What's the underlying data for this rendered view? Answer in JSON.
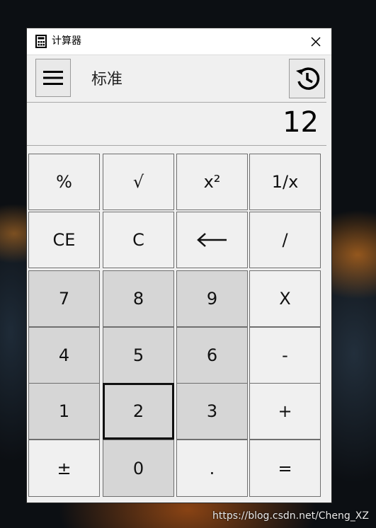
{
  "window": {
    "title": "计算器",
    "close_icon": "close-icon",
    "app_icon": "calculator-icon"
  },
  "header": {
    "menu_icon": "hamburger-icon",
    "mode": "标准",
    "history_icon": "history-icon"
  },
  "display": {
    "value": "12"
  },
  "keys": [
    {
      "label": "%",
      "type": "op"
    },
    {
      "label": "√",
      "type": "op"
    },
    {
      "label": "x²",
      "type": "op"
    },
    {
      "label": "1/x",
      "type": "op"
    },
    {
      "label": "CE",
      "type": "op"
    },
    {
      "label": "C",
      "type": "op"
    },
    {
      "label": "←",
      "type": "op",
      "icon": "backspace-arrow-icon"
    },
    {
      "label": "/",
      "type": "op"
    },
    {
      "label": "7",
      "type": "num"
    },
    {
      "label": "8",
      "type": "num"
    },
    {
      "label": "9",
      "type": "num"
    },
    {
      "label": "X",
      "type": "op"
    },
    {
      "label": "4",
      "type": "num"
    },
    {
      "label": "5",
      "type": "num"
    },
    {
      "label": "6",
      "type": "num"
    },
    {
      "label": "-",
      "type": "op"
    },
    {
      "label": "1",
      "type": "num"
    },
    {
      "label": "2",
      "type": "num",
      "focused": true
    },
    {
      "label": "3",
      "type": "num"
    },
    {
      "label": "+",
      "type": "op"
    },
    {
      "label": "±",
      "type": "op"
    },
    {
      "label": "0",
      "type": "num"
    },
    {
      "label": ".",
      "type": "op"
    },
    {
      "label": "=",
      "type": "op"
    }
  ],
  "watermark": "https://blog.csdn.net/Cheng_XZ"
}
